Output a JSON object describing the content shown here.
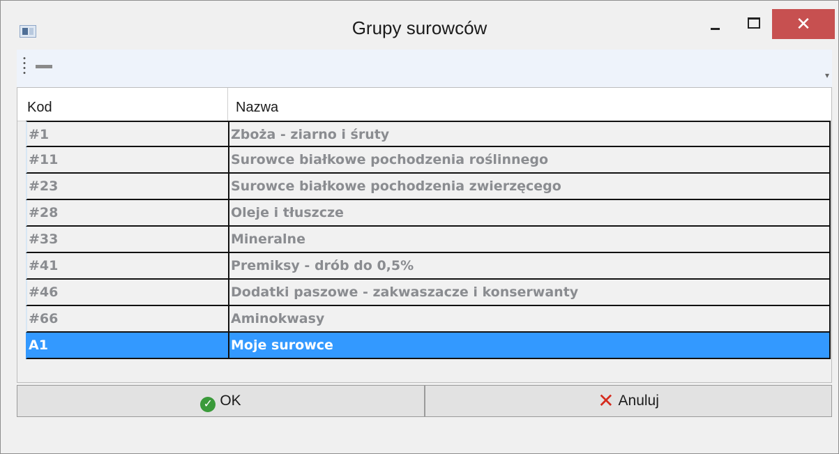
{
  "window": {
    "title": "Grupy surowców",
    "close_glyph": "✕"
  },
  "grid": {
    "headers": {
      "kod": "Kod",
      "nazwa": "Nazwa"
    },
    "rows": [
      {
        "kod": "#1",
        "nazwa": "Zboża - ziarno i śruty"
      },
      {
        "kod": "#11",
        "nazwa": "Surowce białkowe pochodzenia roślinnego"
      },
      {
        "kod": "#23",
        "nazwa": "Surowce białkowe pochodzenia zwierzęcego"
      },
      {
        "kod": "#28",
        "nazwa": "Oleje i tłuszcze"
      },
      {
        "kod": "#33",
        "nazwa": "Mineralne"
      },
      {
        "kod": "#41",
        "nazwa": "Premiksy - drób do 0,5%"
      },
      {
        "kod": "#46",
        "nazwa": "Dodatki paszowe - zakwaszacze i konserwanty"
      },
      {
        "kod": "#66",
        "nazwa": "Aminokwasy"
      },
      {
        "kod": "A1",
        "nazwa": "Moje surowce"
      }
    ],
    "selected_kod": "A1"
  },
  "buttons": {
    "ok_label": "OK",
    "cancel_label": "Anuluj",
    "ok_icon": "check-circle-icon",
    "cancel_icon": "red-x-icon"
  },
  "colors": {
    "selection": "#3399ff",
    "close_button": "#c75050",
    "ok_icon": "#3a9a3a",
    "cancel_icon": "#d52b1e"
  }
}
